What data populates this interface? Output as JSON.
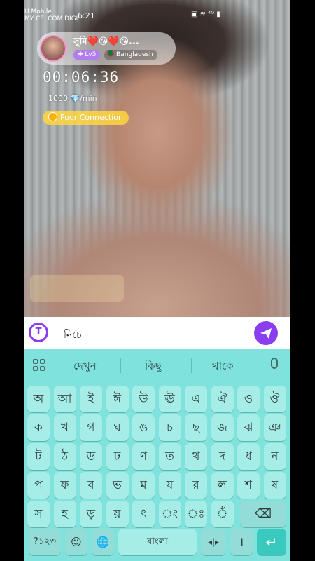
{
  "status_bar": {
    "carrier_line1": "U Mobile",
    "carrier_line2": "MY CELCOM DIGI",
    "time": "6:21",
    "right_icons": "▣ ≋ ⁴ᴳ ▮"
  },
  "profile": {
    "name": "সুমি❤️😘❤️😘...",
    "level": "✚ Lv5",
    "country": "Bangladesh"
  },
  "call": {
    "timer": "00:06:36",
    "rate": "1000 💎/min",
    "connection": "Poor Connection"
  },
  "input": {
    "value": "নিচে"
  },
  "keyboard": {
    "suggestions": [
      "দেখুন",
      "কিছু",
      "থাকে"
    ],
    "rows": [
      [
        "অ",
        "আ",
        "ই",
        "ঈ",
        "উ",
        "ঊ",
        "এ",
        "ঐ",
        "ও",
        "ঔ"
      ],
      [
        "ক",
        "খ",
        "গ",
        "ঘ",
        "ঙ",
        "চ",
        "ছ",
        "জ",
        "ঝ",
        "ঞ"
      ],
      [
        "ট",
        "ঠ",
        "ড",
        "ঢ",
        "ণ",
        "ত",
        "থ",
        "দ",
        "ধ",
        "ন"
      ],
      [
        "প",
        "ফ",
        "ব",
        "ভ",
        "ম",
        "য",
        "র",
        "ল",
        "শ",
        "ষ"
      ],
      [
        "স",
        "হ",
        "ড়",
        "য়",
        "ৎ",
        "ং",
        "ঃ",
        "ঁ"
      ]
    ],
    "symbols_key": "?১২৩",
    "emoji_key": "☺",
    "globe_key": "🌐",
    "space_label": "বাংলা",
    "cursor_key": "◂|▸",
    "danda_key": "।",
    "enter_key": "↵",
    "backspace_key": "⌫"
  },
  "colors": {
    "keyboard_bg": "#7fe2dc",
    "key_bg": "#a6ece7",
    "accent": "#8a3ef0",
    "enter": "#39c9be"
  }
}
